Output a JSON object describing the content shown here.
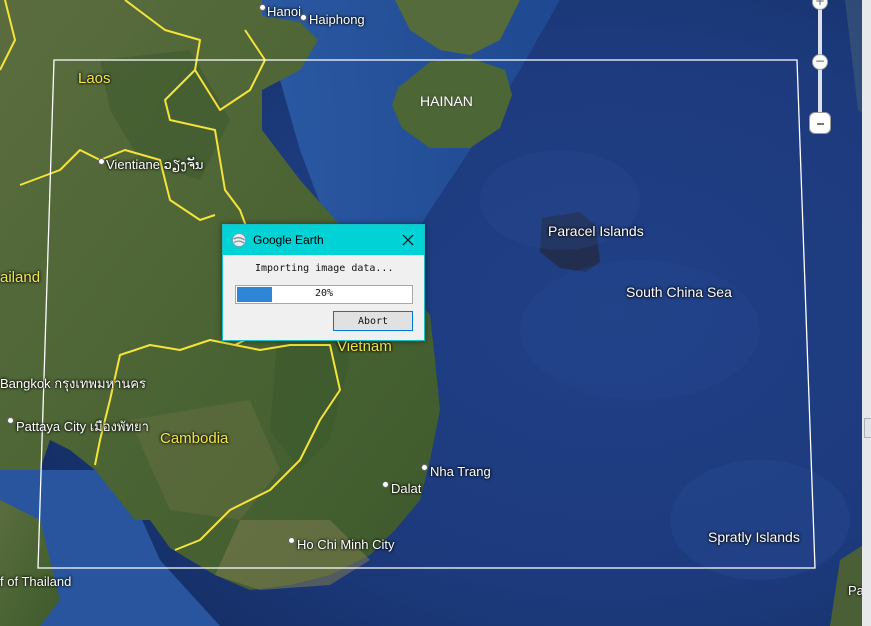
{
  "map": {
    "countries": {
      "laos": "Laos",
      "thailand": "ailand",
      "vietnam": "Vietnam",
      "cambodia": "Cambodia"
    },
    "cities": {
      "hanoi": "Hanoi",
      "haiphong": "Haiphong",
      "vientiane": "Vientiane ວຽງຈັນ",
      "bangkok": "Bangkok กรุงเทพมหานคร",
      "pattaya": "Pattaya City เมืองพัทยา",
      "nha_trang": "Nha Trang",
      "dalat": "Dalat",
      "hcmc": "Ho Chi Minh City"
    },
    "regions": {
      "hainan": "HAINAN",
      "paracel": "Paracel Islands",
      "south_china_sea": "South China Sea",
      "spratly": "Spratly Islands",
      "gulf": "f of Thailand",
      "edge_text": "Pa"
    },
    "colors": {
      "border": "#f5e33a",
      "region_outline": "#ffffff"
    }
  },
  "dialog": {
    "title": "Google Earth",
    "icon": "google-earth-icon",
    "message": "Importing image data...",
    "progress_value": 0.2,
    "progress_text": "20%",
    "abort_label": "Abort",
    "colors": {
      "titlebar": "#00d2d6",
      "progress": "#2f86d6"
    }
  },
  "navigation": {
    "zoom_in": "+",
    "zoom_out": "−"
  }
}
